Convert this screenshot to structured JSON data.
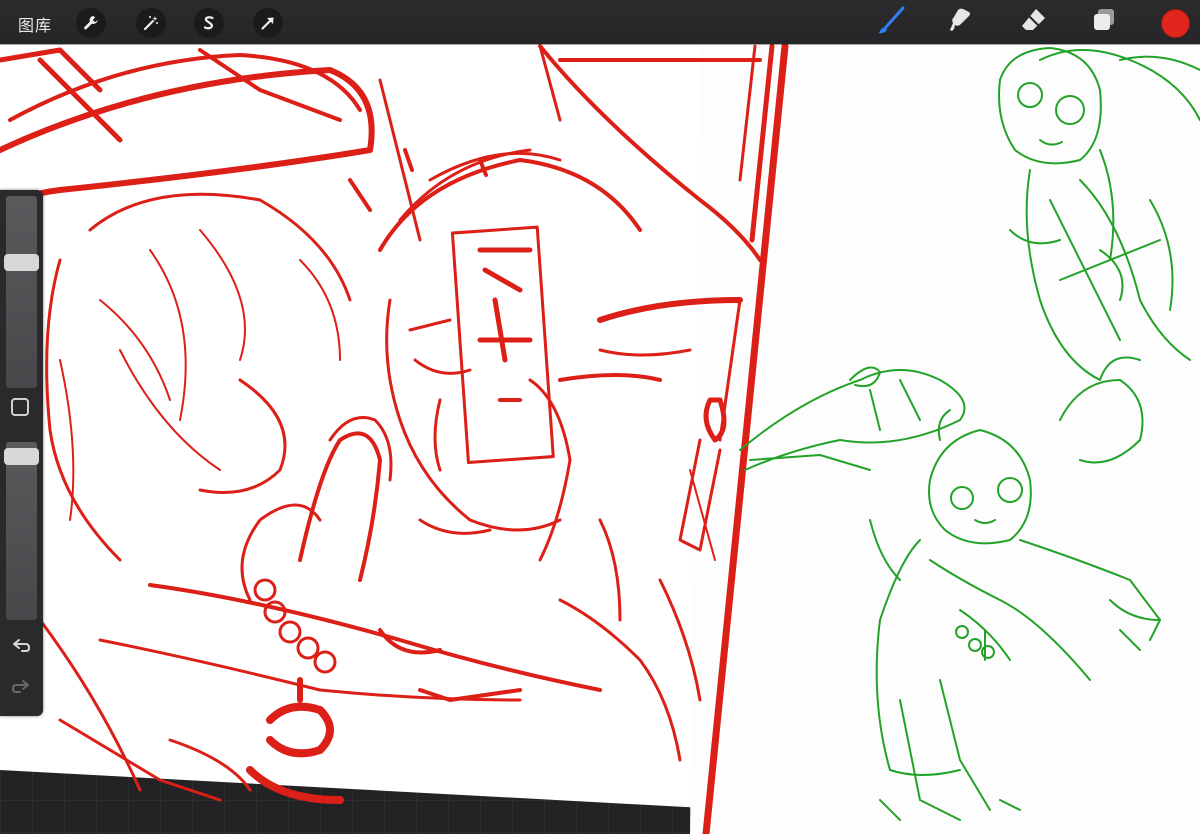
{
  "app": {
    "gallery_label": "图库"
  },
  "toolbar": {
    "left_tools": [
      {
        "icon": "wrench-icon",
        "name": "actions"
      },
      {
        "icon": "magic-wand-icon",
        "name": "adjustments"
      },
      {
        "icon": "selection-icon",
        "name": "selection"
      },
      {
        "icon": "arrow-cursor-icon",
        "name": "transform"
      }
    ],
    "right_tools": [
      {
        "icon": "brush-icon",
        "name": "brush",
        "active": true
      },
      {
        "icon": "smudge-icon",
        "name": "smudge"
      },
      {
        "icon": "eraser-icon",
        "name": "eraser"
      },
      {
        "icon": "layers-icon",
        "name": "layers"
      }
    ],
    "current_color": "#e3261d"
  },
  "sidebar": {
    "brush_size_level": 0.67,
    "opacity_level": 0.96,
    "modify_icon": "square-icon",
    "undo_icon": "undo-icon",
    "redo_icon": "redo-icon"
  },
  "canvas": {
    "sketch_red_color": "#dc1f17",
    "sketch_green_color": "#22a327",
    "paper_color": "#ffffff"
  }
}
